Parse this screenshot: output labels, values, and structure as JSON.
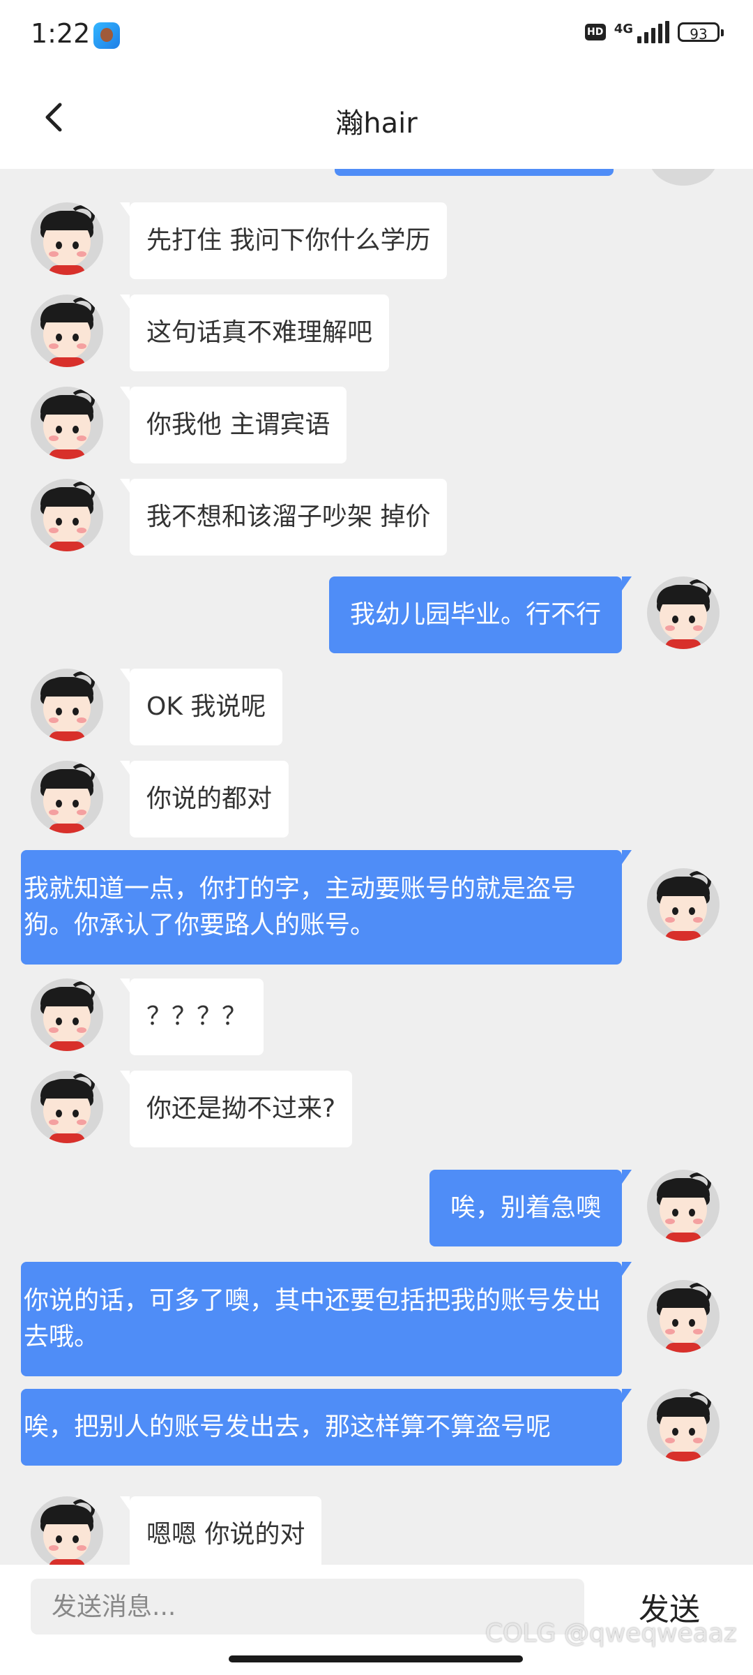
{
  "status_bar": {
    "time": "1:22",
    "hd_badge": "HD",
    "network": "4G",
    "battery": "93"
  },
  "header": {
    "title": "瀚hair",
    "back_icon": "chevron-left-icon"
  },
  "messages": [
    {
      "side": "left",
      "text": "先打住  我问下你什么学历"
    },
    {
      "side": "left",
      "text": "这句话真不难理解吧"
    },
    {
      "side": "left",
      "text": "你我他 主谓宾语"
    },
    {
      "side": "left",
      "text": "我不想和该溜子吵架  掉价"
    },
    {
      "side": "right",
      "text": "我幼儿园毕业。行不行"
    },
    {
      "side": "left",
      "text": "OK  我说呢"
    },
    {
      "side": "left",
      "text": "你说的都对"
    },
    {
      "side": "right",
      "text": "我就知道一点，你打的字，主动要账号的就是盗号狗。你承认了你要路人的账号。"
    },
    {
      "side": "left",
      "text": "？？？？"
    },
    {
      "side": "left",
      "text": "你还是拗不过来?"
    },
    {
      "side": "right",
      "text": "唉，别着急噢"
    },
    {
      "side": "right",
      "text": "你说的话，可多了噢，其中还要包括把我的账号发出去哦。"
    },
    {
      "side": "right",
      "text": "唉，把别人的账号发出去，那这样算不算盗号呢"
    },
    {
      "side": "left",
      "text": "嗯嗯   你说的对"
    }
  ],
  "input_bar": {
    "placeholder": "发送消息...",
    "send_label": "发送"
  },
  "watermark": "COLG @qweqweaaz",
  "colors": {
    "own_bubble": "#4f8df7",
    "other_bubble": "#ffffff",
    "background": "#efefef"
  }
}
